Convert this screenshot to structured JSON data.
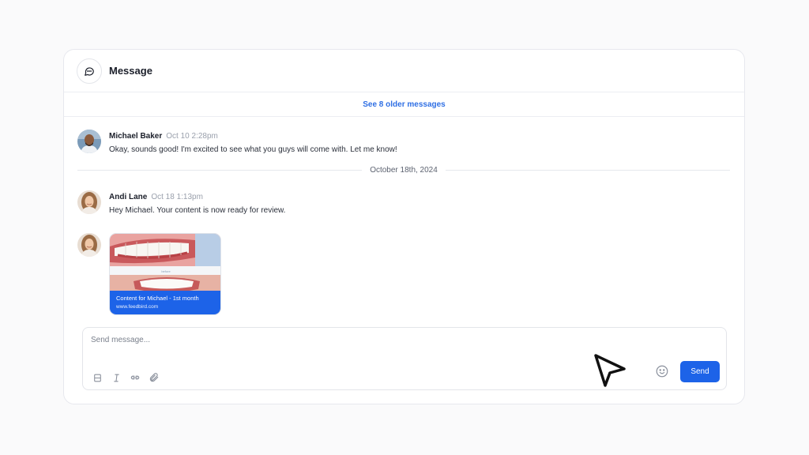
{
  "header": {
    "title": "Message",
    "icon": "chat-bubble-icon"
  },
  "older_messages": {
    "label": "See 8 older messages"
  },
  "messages": [
    {
      "author": "Michael Baker",
      "time": "Oct 10 2:28pm",
      "text": "Okay, sounds good! I'm excited to see what you guys will come with. Let me know!"
    },
    {
      "author": "Andi Lane",
      "time": "Oct 18 1:13pm",
      "text": "Hey Michael. Your content is now ready for review."
    }
  ],
  "date_divider": "October 18th, 2024",
  "attachment": {
    "title": "Content for Michael - 1st month",
    "url": "www.feedbird.com",
    "mid_label": "before"
  },
  "composer": {
    "placeholder": "Send message...",
    "send_label": "Send",
    "tools": [
      "bold-icon",
      "italic-icon",
      "link-icon",
      "paperclip-icon"
    ],
    "emoji_icon": "smiley-icon"
  },
  "colors": {
    "accent": "#1d63e8",
    "link": "#2f6fe4"
  }
}
